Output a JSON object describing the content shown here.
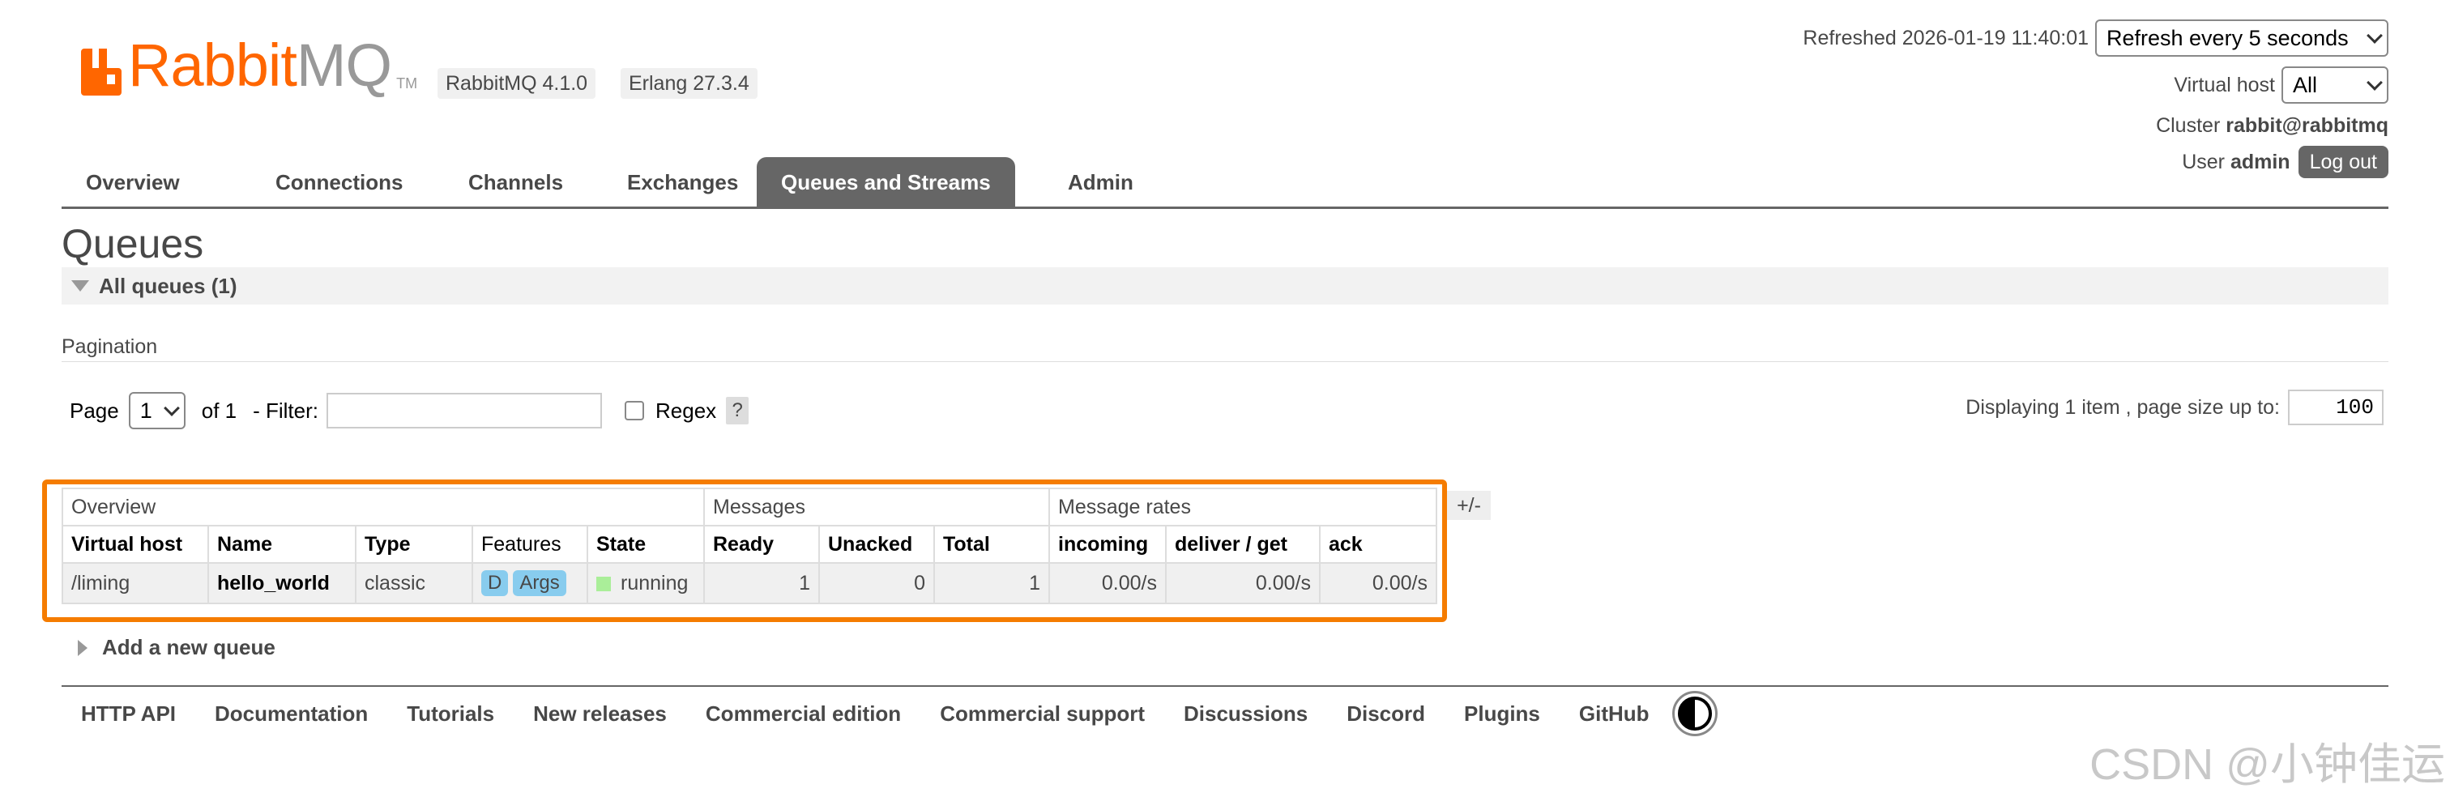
{
  "header": {
    "logo_text_rabbit": "Rabbit",
    "logo_text_mq": "MQ",
    "logo_tm": "TM",
    "rabbitmq_version": "RabbitMQ 4.1.0",
    "erlang_version": "Erlang 27.3.4",
    "refreshed_label": "Refreshed 2026-01-19 11:40:01",
    "refresh_select_value": "Refresh every 5 seconds",
    "vhost_label": "Virtual host",
    "vhost_select_value": "All",
    "cluster_label": "Cluster",
    "cluster_value": "rabbit@rabbitmq",
    "user_label": "User",
    "user_value": "admin",
    "logout_label": "Log out"
  },
  "tabs": [
    {
      "label": "Overview",
      "active": false
    },
    {
      "label": "Connections",
      "active": false
    },
    {
      "label": "Channels",
      "active": false
    },
    {
      "label": "Exchanges",
      "active": false
    },
    {
      "label": "Queues and Streams",
      "active": true
    },
    {
      "label": "Admin",
      "active": false
    }
  ],
  "main": {
    "title": "Queues",
    "section_label": "All queues (1)",
    "pagination_label": "Pagination",
    "page_label": "Page",
    "page_value": "1",
    "of_label": "of 1",
    "filter_label": "- Filter:",
    "filter_value": "",
    "regex_label": "Regex",
    "regex_help": "?",
    "display_label": "Displaying 1 item , page size up to:",
    "page_size_value": "100",
    "columns_toggle": "+/-",
    "add_queue_label": "Add a new queue"
  },
  "table": {
    "groups": [
      "Overview",
      "Messages",
      "Message rates"
    ],
    "headers": [
      "Virtual host",
      "Name",
      "Type",
      "Features",
      "State",
      "Ready",
      "Unacked",
      "Total",
      "incoming",
      "deliver / get",
      "ack"
    ],
    "rows": [
      {
        "vhost": "/liming",
        "name": "hello_world",
        "type": "classic",
        "features": [
          "D",
          "Args"
        ],
        "state": "running",
        "ready": "1",
        "unacked": "0",
        "total": "1",
        "incoming": "0.00/s",
        "deliver_get": "0.00/s",
        "ack": "0.00/s"
      }
    ]
  },
  "footer": {
    "links": [
      "HTTP API",
      "Documentation",
      "Tutorials",
      "New releases",
      "Commercial edition",
      "Commercial support",
      "Discussions",
      "Discord",
      "Plugins",
      "GitHub"
    ]
  },
  "watermark": "CSDN @小钟佳运",
  "colors": {
    "brand_orange": "#ff6600",
    "tab_active_bg": "#666666",
    "highlight_border": "#f57c00",
    "feature_badge": "#88ccee",
    "state_running": "#aaee99"
  }
}
